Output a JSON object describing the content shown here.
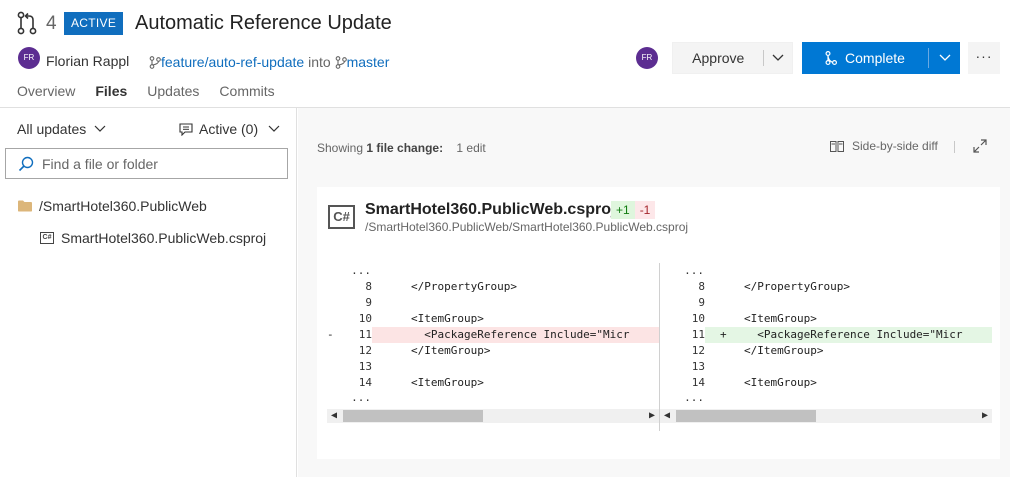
{
  "header": {
    "pr_number": "4",
    "status_badge": "ACTIVE",
    "title": "Automatic Reference Update",
    "author": {
      "initials": "FR",
      "name": "Florian Rappl"
    },
    "source_branch": "feature/auto-ref-update",
    "into_text": "into",
    "target_branch": "master",
    "reviewer_initials": "FR",
    "approve_label": "Approve",
    "complete_label": "Complete",
    "more_label": "···"
  },
  "tabs": [
    {
      "label": "Overview",
      "active": false
    },
    {
      "label": "Files",
      "active": true
    },
    {
      "label": "Updates",
      "active": false
    },
    {
      "label": "Commits",
      "active": false
    }
  ],
  "sidebar": {
    "updates_filter": "All updates",
    "comments_filter": "Active (0)",
    "search_placeholder": "Find a file or folder",
    "folder": "/SmartHotel360.PublicWeb",
    "file": "SmartHotel360.PublicWeb.csproj"
  },
  "summary": {
    "showing_prefix": "Showing",
    "showing_count": "1 file change:",
    "edits": "1 edit",
    "view_mode": "Side-by-side diff"
  },
  "file": {
    "icon_text": "C#",
    "name": "SmartHotel360.PublicWeb.csproj",
    "additions": "+1",
    "deletions": "-1",
    "path": "/SmartHotel360.PublicWeb/SmartHotel360.PublicWeb.csproj"
  },
  "diff": {
    "ellipsis": "...",
    "left": [
      {
        "ln": "8",
        "mark": "",
        "code": "</PropertyGroup>",
        "kind": "ctx"
      },
      {
        "ln": "9",
        "mark": "",
        "code": "",
        "kind": "ctx"
      },
      {
        "ln": "10",
        "mark": "",
        "code": "<ItemGroup>",
        "kind": "ctx"
      },
      {
        "ln": "11",
        "mark": "-",
        "code": "  <PackageReference Include=\"Micr",
        "kind": "del"
      },
      {
        "ln": "12",
        "mark": "",
        "code": "</ItemGroup>",
        "kind": "ctx"
      },
      {
        "ln": "13",
        "mark": "",
        "code": "",
        "kind": "ctx"
      },
      {
        "ln": "14",
        "mark": "",
        "code": "<ItemGroup>",
        "kind": "ctx"
      }
    ],
    "right": [
      {
        "ln": "8",
        "mark": "",
        "code": "</PropertyGroup>",
        "kind": "ctx"
      },
      {
        "ln": "9",
        "mark": "",
        "code": "",
        "kind": "ctx"
      },
      {
        "ln": "10",
        "mark": "",
        "code": "<ItemGroup>",
        "kind": "ctx"
      },
      {
        "ln": "11",
        "mark": "+",
        "code": "  <PackageReference Include=\"Micr",
        "kind": "add"
      },
      {
        "ln": "12",
        "mark": "",
        "code": "</ItemGroup>",
        "kind": "ctx"
      },
      {
        "ln": "13",
        "mark": "",
        "code": "",
        "kind": "ctx"
      },
      {
        "ln": "14",
        "mark": "",
        "code": "<ItemGroup>",
        "kind": "ctx"
      }
    ]
  },
  "colors": {
    "accent": "#0078d4",
    "badge": "#106ebe",
    "avatar": "#5c2d91",
    "deleted_bg": "#fce4e4",
    "added_bg": "#e4f6e4"
  }
}
